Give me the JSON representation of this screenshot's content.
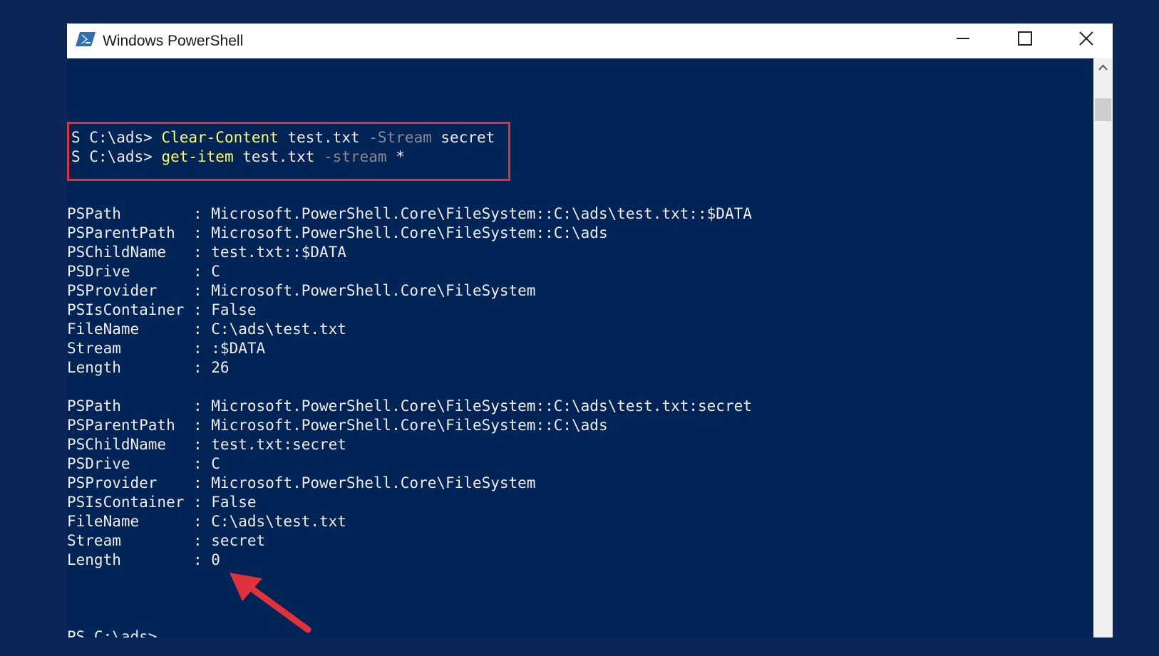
{
  "window": {
    "title": "Windows PowerShell"
  },
  "icons": {
    "app": "powershell-icon",
    "minimize": "minimize-icon",
    "maximize": "maximize-icon",
    "close": "close-icon",
    "scroll_up": "chevron-up-icon",
    "annotation": "arrow-icon"
  },
  "colors": {
    "console_bg": "#012456",
    "command_name": "#ffff66",
    "parameter": "#8a8a8a",
    "highlight_box": "#e0323a",
    "arrow": "#e0323a"
  },
  "commands": [
    {
      "prompt": "S C:\\ads> ",
      "name": "Clear-Content",
      "target": " test.txt ",
      "param": "-Stream",
      "value": " secret"
    },
    {
      "prompt": "S C:\\ads> ",
      "name": "get-item",
      "target": " test.txt ",
      "param": "-stream",
      "value": " *"
    }
  ],
  "output_blocks": [
    [
      "PSPath        : Microsoft.PowerShell.Core\\FileSystem::C:\\ads\\test.txt::$DATA",
      "PSParentPath  : Microsoft.PowerShell.Core\\FileSystem::C:\\ads",
      "PSChildName   : test.txt::$DATA",
      "PSDrive       : C",
      "PSProvider    : Microsoft.PowerShell.Core\\FileSystem",
      "PSIsContainer : False",
      "FileName      : C:\\ads\\test.txt",
      "Stream        : :$DATA",
      "Length        : 26"
    ],
    [
      "PSPath        : Microsoft.PowerShell.Core\\FileSystem::C:\\ads\\test.txt:secret",
      "PSParentPath  : Microsoft.PowerShell.Core\\FileSystem::C:\\ads",
      "PSChildName   : test.txt:secret",
      "PSDrive       : C",
      "PSProvider    : Microsoft.PowerShell.Core\\FileSystem",
      "PSIsContainer : False",
      "FileName      : C:\\ads\\test.txt",
      "Stream        : secret",
      "Length        : 0"
    ]
  ],
  "final_prompt": "PS C:\\ads>"
}
